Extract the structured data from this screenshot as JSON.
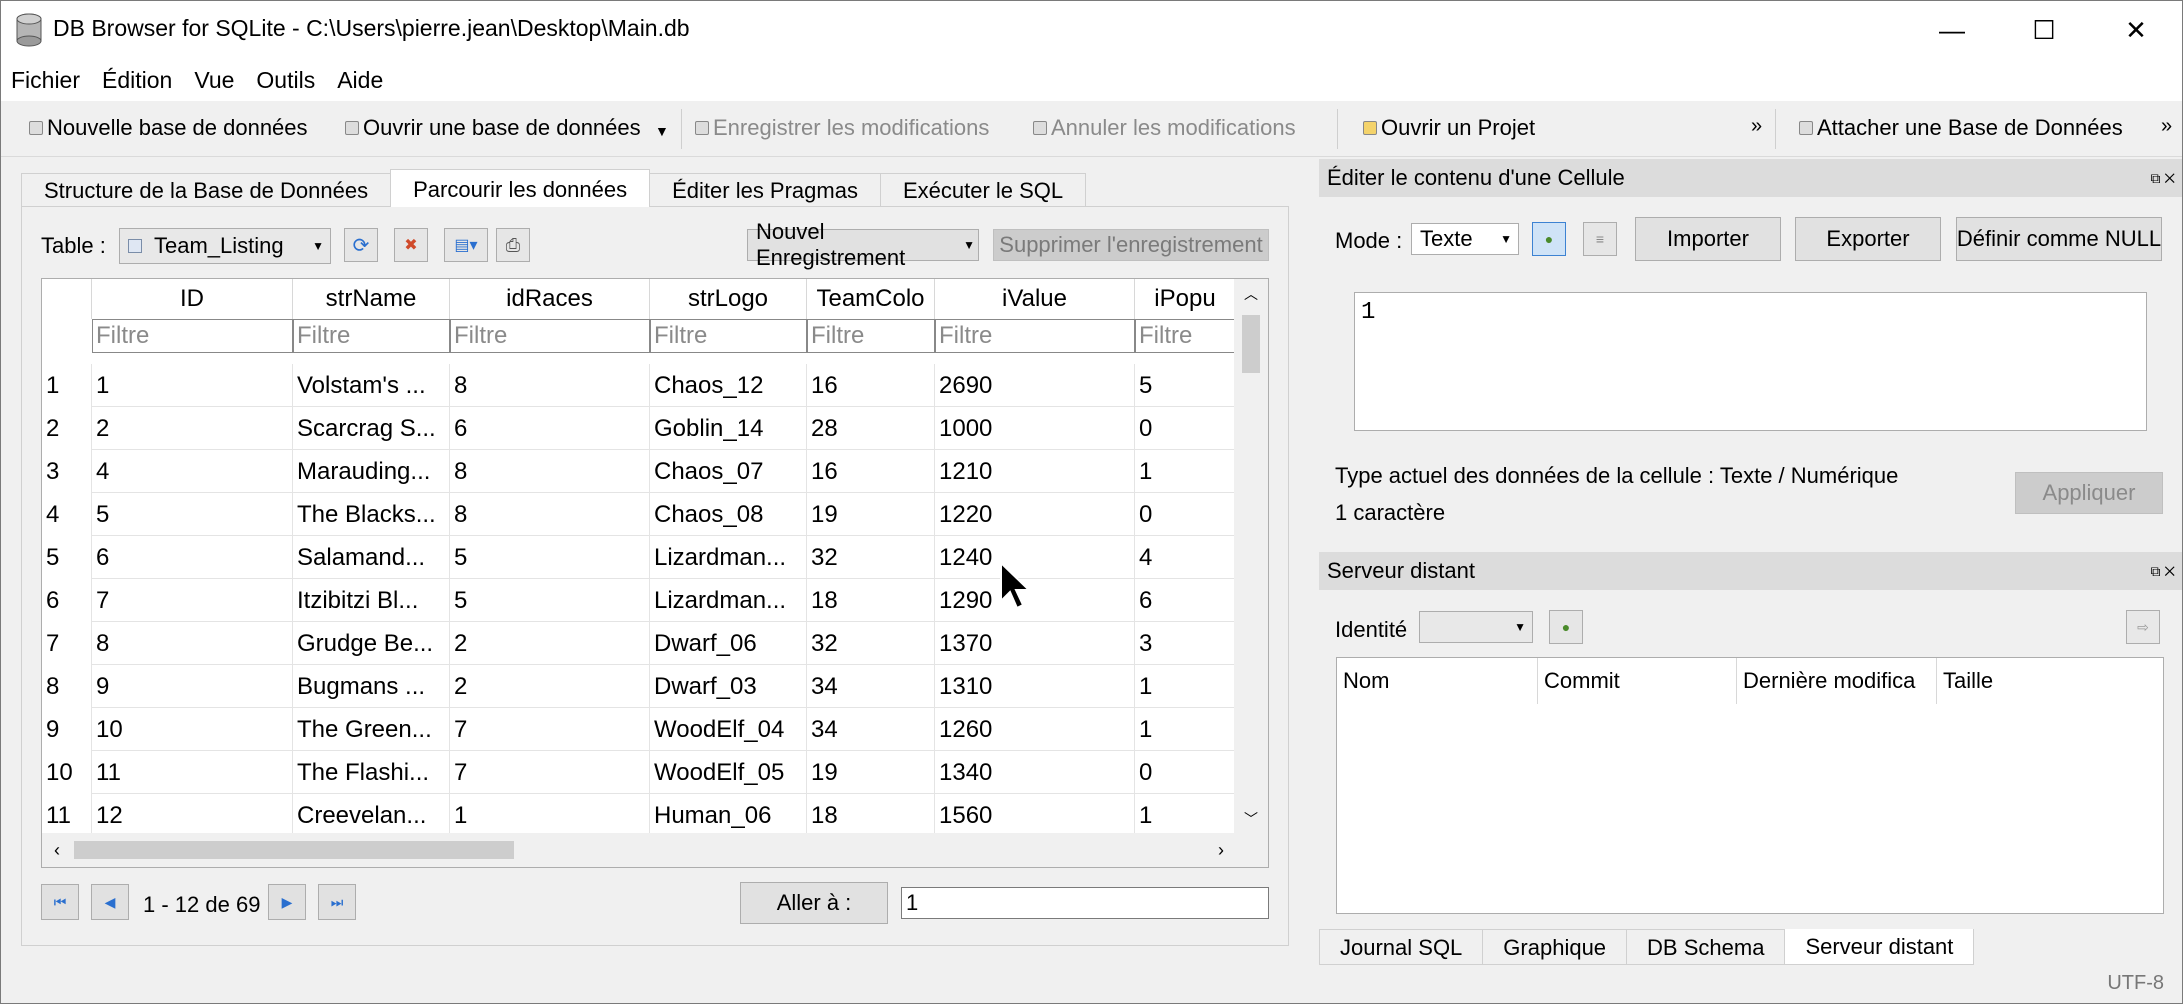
{
  "window": {
    "title": "DB Browser for SQLite - C:\\Users\\pierre.jean\\Desktop\\Main.db",
    "minimize": "—",
    "maximize": "☐",
    "close": "✕"
  },
  "menu": [
    "Fichier",
    "Édition",
    "Vue",
    "Outils",
    "Aide"
  ],
  "toolbar": {
    "new_db": "Nouvelle base de données",
    "open_db": "Ouvrir une base de données",
    "write_changes": "Enregistrer les modifications",
    "revert_changes": "Annuler les modifications",
    "open_project": "Ouvrir un Projet",
    "attach_db": "Attacher une Base de Données",
    "more": "»"
  },
  "tabs": [
    "Structure de la Base de Données",
    "Parcourir les données",
    "Éditer les Pragmas",
    "Exécuter le SQL"
  ],
  "active_tab": 1,
  "browse": {
    "table_label": "Table :",
    "table_value": "Team_Listing",
    "new_record": "Nouvel Enregistrement",
    "delete_record": "Supprimer l'enregistrement",
    "columns": [
      "ID",
      "strName",
      "idRaces",
      "strLogo",
      "TeamColo",
      "iValue",
      "iPopu"
    ],
    "filter_placeholder": "Filtre",
    "rows": [
      {
        "n": "1",
        "cells": [
          "1",
          "Volstam's ...",
          "8",
          "Chaos_12",
          "16",
          "2690",
          "5"
        ]
      },
      {
        "n": "2",
        "cells": [
          "2",
          "Scarcrag S...",
          "6",
          "Goblin_14",
          "28",
          "1000",
          "0"
        ]
      },
      {
        "n": "3",
        "cells": [
          "4",
          "Marauding...",
          "8",
          "Chaos_07",
          "16",
          "1210",
          "1"
        ]
      },
      {
        "n": "4",
        "cells": [
          "5",
          "The Blacks...",
          "8",
          "Chaos_08",
          "19",
          "1220",
          "0"
        ]
      },
      {
        "n": "5",
        "cells": [
          "6",
          "Salamand...",
          "5",
          "Lizardman...",
          "32",
          "1240",
          "4"
        ]
      },
      {
        "n": "6",
        "cells": [
          "7",
          "Itzibitzi Bl...",
          "5",
          "Lizardman...",
          "18",
          "1290",
          "6"
        ]
      },
      {
        "n": "7",
        "cells": [
          "8",
          "Grudge Be...",
          "2",
          "Dwarf_06",
          "32",
          "1370",
          "3"
        ]
      },
      {
        "n": "8",
        "cells": [
          "9",
          "Bugmans ...",
          "2",
          "Dwarf_03",
          "34",
          "1310",
          "1"
        ]
      },
      {
        "n": "9",
        "cells": [
          "10",
          "The Green...",
          "7",
          "WoodElf_04",
          "34",
          "1260",
          "1"
        ]
      },
      {
        "n": "10",
        "cells": [
          "11",
          "The Flashi...",
          "7",
          "WoodElf_05",
          "19",
          "1340",
          "0"
        ]
      },
      {
        "n": "11",
        "cells": [
          "12",
          "Creevelan...",
          "1",
          "Human_06",
          "18",
          "1560",
          "1"
        ]
      }
    ],
    "page_info": "1 - 12 de 69",
    "goto_label": "Aller à :",
    "goto_value": "1"
  },
  "cell_editor": {
    "title": "Éditer le contenu d'une Cellule",
    "mode_label": "Mode :",
    "mode_value": "Texte",
    "import": "Importer",
    "export": "Exporter",
    "set_null": "Définir comme NULL",
    "content": "1",
    "type_info": "Type actuel des données de la cellule : Texte / Numérique",
    "size_info": "1 caractère",
    "apply": "Appliquer"
  },
  "remote": {
    "title": "Serveur distant",
    "identity_label": "Identité",
    "columns": [
      "Nom",
      "Commit",
      "Dernière modifica",
      "Taille"
    ]
  },
  "bottom_tabs": [
    "Journal SQL",
    "Graphique",
    "DB Schema",
    "Serveur distant"
  ],
  "bottom_active": 3,
  "status_encoding": "UTF-8"
}
